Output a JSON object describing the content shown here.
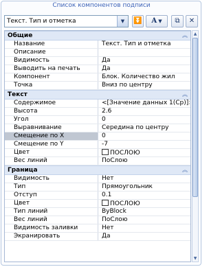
{
  "title": "Список компонентов подписи",
  "toolbar": {
    "selected": "Текст. Тип и отметка",
    "font_button": "A"
  },
  "sections": [
    {
      "label": "Общие",
      "rows": [
        {
          "name": "Название",
          "value": "Текст. Тип и отметка"
        },
        {
          "name": "Описание",
          "value": ""
        },
        {
          "name": "Видимость",
          "value": "Да"
        },
        {
          "name": "Выводить на печать",
          "value": "Да"
        },
        {
          "name": "Компонент",
          "value": "Блок. Количество жил"
        },
        {
          "name": "Точка",
          "value": "Вниз по центру"
        }
      ]
    },
    {
      "label": "Текст",
      "rows": [
        {
          "name": "Содержимое",
          "value": "<[Значение данных 1(Ср)]>|<..."
        },
        {
          "name": "Высота",
          "value": "2.6"
        },
        {
          "name": "Угол",
          "value": "0"
        },
        {
          "name": "Выравнивание",
          "value": "Середина по центру"
        },
        {
          "name": "Смещение по X",
          "value": "0"
        },
        {
          "name": "Смещение по Y",
          "value": "-7"
        },
        {
          "name": "Цвет",
          "value": "ПОСЛОЮ"
        },
        {
          "name": "Вес линий",
          "value": "ПоСлою"
        }
      ]
    },
    {
      "label": "Граница",
      "rows": [
        {
          "name": "Видимость",
          "value": "Нет"
        },
        {
          "name": "Тип",
          "value": "Прямоугольник"
        },
        {
          "name": "Отступ",
          "value": "0.1"
        },
        {
          "name": "Цвет",
          "value": "ПОСЛОЮ"
        },
        {
          "name": "Тип линий",
          "value": "ByBlock"
        },
        {
          "name": "Вес линий",
          "value": "ПоСлою"
        },
        {
          "name": "Видимость заливки",
          "value": "Нет"
        },
        {
          "name": "Экранировать",
          "value": "Да"
        }
      ]
    }
  ]
}
